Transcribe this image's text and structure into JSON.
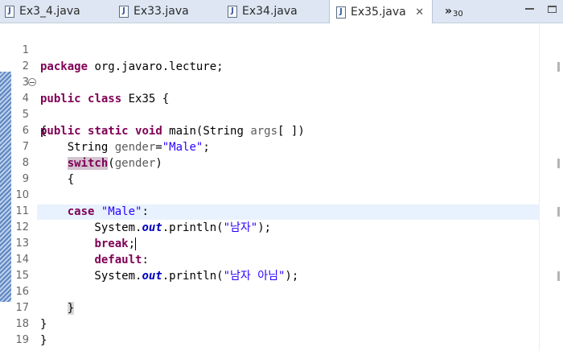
{
  "tabs": [
    {
      "label": "Ex3_4.java",
      "active": false
    },
    {
      "label": "Ex33.java",
      "active": false
    },
    {
      "label": "Ex34.java",
      "active": false
    },
    {
      "label": "Ex35.java",
      "active": true
    }
  ],
  "tab_icon_letter": "J",
  "tab_close_glyph": "✕",
  "overflow": {
    "chevron": "»",
    "count": "30"
  },
  "window_controls": [
    "minimize-icon",
    "maximize-icon"
  ],
  "colors": {
    "keyword": "#7f0055",
    "string": "#2a00ff",
    "static_field": "#0000c0",
    "current_line": "#e8f2fe"
  },
  "code": {
    "current_line": 12,
    "lines": [
      {
        "n": "1",
        "t": [
          "package",
          " org.javaro.lecture;"
        ]
      },
      {
        "n": "2",
        "t": []
      },
      {
        "n": "3",
        "t": [
          "public",
          " ",
          "class",
          " Ex35 {"
        ]
      },
      {
        "n": "4",
        "t": [
          "public",
          " ",
          "static",
          " ",
          "void",
          " main(String ",
          "args",
          "[ ])"
        ]
      },
      {
        "n": "5",
        "t": [
          "{"
        ]
      },
      {
        "n": "6",
        "t": [
          "    String ",
          "gender",
          "=",
          "\"Male\"",
          ";"
        ]
      },
      {
        "n": "7",
        "t": [
          "    ",
          "switch",
          "(",
          "gender",
          ")"
        ]
      },
      {
        "n": "8",
        "t": [
          "    {"
        ]
      },
      {
        "n": "9",
        "t": []
      },
      {
        "n": "10",
        "t": [
          "    ",
          "case",
          " ",
          "\"Male\"",
          ":"
        ]
      },
      {
        "n": "11",
        "t": [
          "        System.",
          "out",
          ".println(",
          "\"남자\"",
          ");"
        ]
      },
      {
        "n": "12",
        "t": [
          "        ",
          "break",
          ";"
        ]
      },
      {
        "n": "13",
        "t": [
          "        ",
          "default",
          ":"
        ]
      },
      {
        "n": "14",
        "t": [
          "        System.",
          "out",
          ".println(",
          "\"남자 아님\"",
          ");"
        ]
      },
      {
        "n": "15",
        "t": []
      },
      {
        "n": "16",
        "t": [
          "    ",
          "}"
        ]
      },
      {
        "n": "17",
        "t": [
          "}"
        ]
      },
      {
        "n": "18",
        "t": [
          "}"
        ]
      },
      {
        "n": "19",
        "t": []
      }
    ]
  }
}
